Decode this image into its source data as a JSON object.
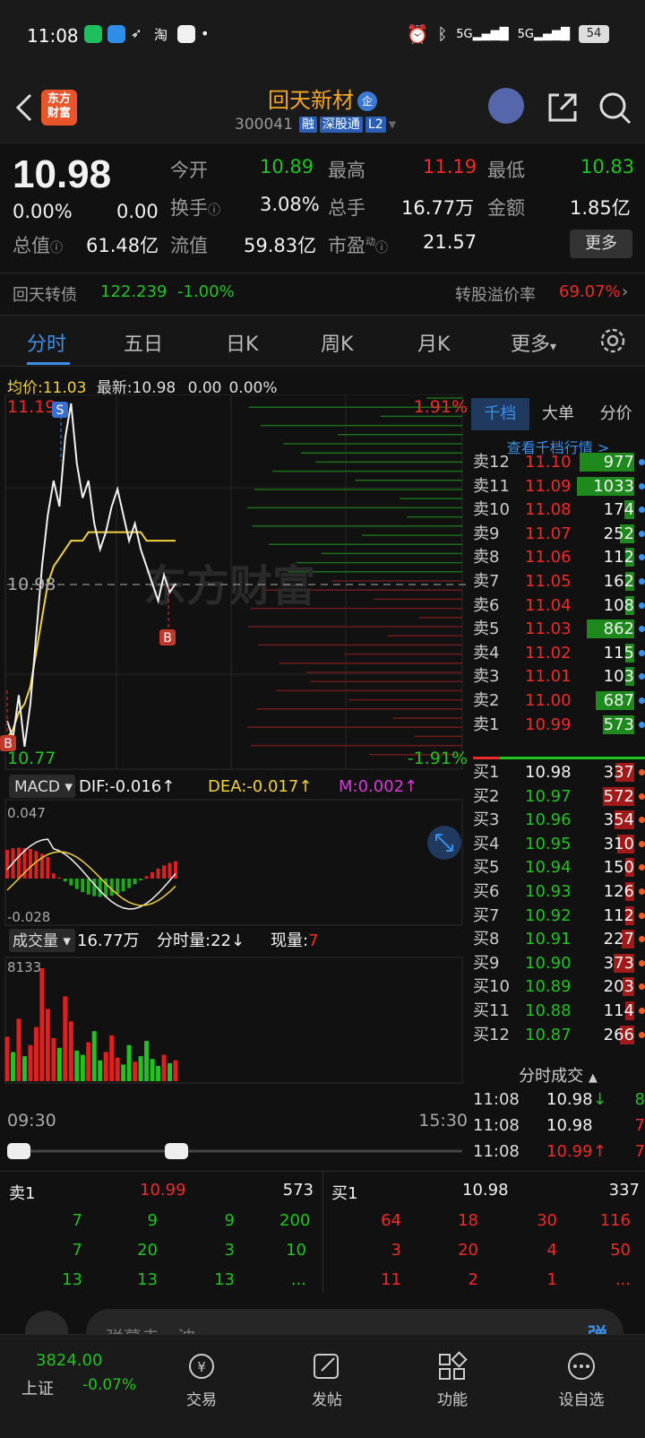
{
  "status": {
    "time": "11:08",
    "battery": "54",
    "sig1": "5G",
    "sig2": "5G"
  },
  "header": {
    "title": "回天新材",
    "badge": "企",
    "code": "300041",
    "tags": [
      "融",
      "深股通",
      "L2"
    ],
    "logo_text": "东方财富"
  },
  "quote": {
    "price": "10.98",
    "change_pct": "0.00%",
    "change": "0.00",
    "open_label": "今开",
    "open": "10.89",
    "high_label": "最高",
    "high": "11.19",
    "low_label": "最低",
    "low": "10.83",
    "turnover_label": "换手",
    "turnover": "3.08%",
    "volume_label": "总手",
    "volume": "16.77万",
    "amount_label": "金额",
    "amount": "1.85亿",
    "mktcap_label": "总值",
    "mktcap": "61.48亿",
    "float_label": "流值",
    "float": "59.83亿",
    "pe_label": "市盈",
    "pe_sup": "动",
    "pe": "21.57",
    "more": "更多",
    "bond_name": "回天转债",
    "bond_price": "122.239",
    "bond_change": "-1.00%",
    "premium_label": "转股溢价率",
    "premium": "69.07%"
  },
  "tabs": [
    "分时",
    "五日",
    "日K",
    "周K",
    "月K",
    "更多"
  ],
  "avg": {
    "avg_label": "均价:",
    "avg": "11.03",
    "latest_label": "最新:",
    "latest": "10.98",
    "chg": "0.00",
    "pct": "0.00%"
  },
  "chart": {
    "price_top": "11.19",
    "price_mid": "10.98",
    "price_bot": "10.77",
    "pct_top": "1.91%",
    "pct_bot": "-1.91%",
    "watermark": "东方财富",
    "mark_s": "S",
    "mark_b": "B",
    "macd_label": "MACD",
    "dif": "DIF:-0.016↑",
    "dea": "DEA:-0.017↑",
    "m": "M:0.002↑",
    "macd_top": "0.047",
    "macd_bot": "-0.028",
    "vol_label": "成交量",
    "vol_total": "16.77万",
    "vol_min_label": "分时量:",
    "vol_min": "22↓",
    "vol_now_label": "现量:",
    "vol_now": "7",
    "vol_max": "8133",
    "time_start": "09:30",
    "time_end": "15:30"
  },
  "chart_data": {
    "type": "line",
    "series": [],
    "x_start": "09:30",
    "x_end": "15:30",
    "y_range": [
      10.77,
      11.19
    ],
    "prev_close": 10.98,
    "price": [
      10.82,
      10.8,
      10.85,
      10.79,
      10.84,
      10.92,
      11.0,
      11.06,
      11.1,
      11.07,
      11.15,
      11.19,
      11.12,
      11.08,
      11.1,
      11.05,
      11.02,
      11.04,
      11.07,
      11.09,
      11.06,
      11.03,
      11.05,
      11.02,
      11.0,
      10.98,
      10.96,
      10.99,
      10.97,
      10.98
    ],
    "avg": [
      10.8,
      10.81,
      10.83,
      10.84,
      10.86,
      10.9,
      10.94,
      10.98,
      11.0,
      11.01,
      11.02,
      11.03,
      11.03,
      11.03,
      11.04,
      11.04,
      11.04,
      11.04,
      11.04,
      11.04,
      11.04,
      11.04,
      11.04,
      11.04,
      11.03,
      11.03,
      11.03,
      11.03,
      11.03,
      11.03
    ],
    "volume": [
      3200,
      2100,
      4500,
      1800,
      2600,
      3900,
      8133,
      5200,
      3100,
      2400,
      6100,
      4300,
      2200,
      1900,
      2800,
      3600,
      1500,
      2100,
      3300,
      1700,
      1200,
      2600,
      1400,
      1800,
      2900,
      1600,
      1100,
      1900,
      1300,
      1500
    ]
  },
  "depth": {
    "tabs": [
      "千档",
      "大单",
      "分价"
    ],
    "link": "查看千档行情 >",
    "asks": [
      {
        "l": "卖12",
        "p": "11.10",
        "v": "977"
      },
      {
        "l": "卖11",
        "p": "11.09",
        "v": "1033"
      },
      {
        "l": "卖10",
        "p": "11.08",
        "v": "174"
      },
      {
        "l": "卖9",
        "p": "11.07",
        "v": "252"
      },
      {
        "l": "卖8",
        "p": "11.06",
        "v": "112"
      },
      {
        "l": "卖7",
        "p": "11.05",
        "v": "162"
      },
      {
        "l": "卖6",
        "p": "11.04",
        "v": "108"
      },
      {
        "l": "卖5",
        "p": "11.03",
        "v": "862"
      },
      {
        "l": "卖4",
        "p": "11.02",
        "v": "115"
      },
      {
        "l": "卖3",
        "p": "11.01",
        "v": "103"
      },
      {
        "l": "卖2",
        "p": "11.00",
        "v": "687"
      },
      {
        "l": "卖1",
        "p": "10.99",
        "v": "573"
      }
    ],
    "bids": [
      {
        "l": "买1",
        "p": "10.98",
        "v": "337"
      },
      {
        "l": "买2",
        "p": "10.97",
        "v": "572"
      },
      {
        "l": "买3",
        "p": "10.96",
        "v": "354"
      },
      {
        "l": "买4",
        "p": "10.95",
        "v": "310"
      },
      {
        "l": "买5",
        "p": "10.94",
        "v": "150"
      },
      {
        "l": "买6",
        "p": "10.93",
        "v": "126"
      },
      {
        "l": "买7",
        "p": "10.92",
        "v": "112"
      },
      {
        "l": "买8",
        "p": "10.91",
        "v": "227"
      },
      {
        "l": "买9",
        "p": "10.90",
        "v": "373"
      },
      {
        "l": "买10",
        "p": "10.89",
        "v": "203"
      },
      {
        "l": "买11",
        "p": "10.88",
        "v": "114"
      },
      {
        "l": "买12",
        "p": "10.87",
        "v": "266"
      }
    ],
    "trades_label": "分时成交",
    "trades": [
      {
        "t": "11:08",
        "p": "10.98",
        "a": "↓",
        "v": "8"
      },
      {
        "t": "11:08",
        "p": "10.98",
        "a": "",
        "v": "7"
      },
      {
        "t": "11:08",
        "p": "10.99",
        "a": "↑",
        "v": "7"
      }
    ]
  },
  "bottombook": {
    "ask_label": "卖1",
    "ask_price": "10.99",
    "ask_vol": "573",
    "bid_label": "买1",
    "bid_price": "10.98",
    "bid_vol": "337",
    "ask_rows": [
      [
        "7",
        "9",
        "9",
        "200"
      ],
      [
        "7",
        "20",
        "3",
        "10"
      ],
      [
        "13",
        "13",
        "13",
        "..."
      ]
    ],
    "bid_rows": [
      [
        "64",
        "18",
        "30",
        "116"
      ],
      [
        "3",
        "20",
        "4",
        "50"
      ],
      [
        "11",
        "2",
        "1",
        "..."
      ]
    ]
  },
  "comment": {
    "placeholder": "弹幕走一波",
    "btn": "弹"
  },
  "nav": {
    "index_value": "3824.00",
    "index_name": "上证",
    "index_chg": "-0.07%",
    "items": [
      "交易",
      "发帖",
      "功能",
      "设自选"
    ]
  }
}
